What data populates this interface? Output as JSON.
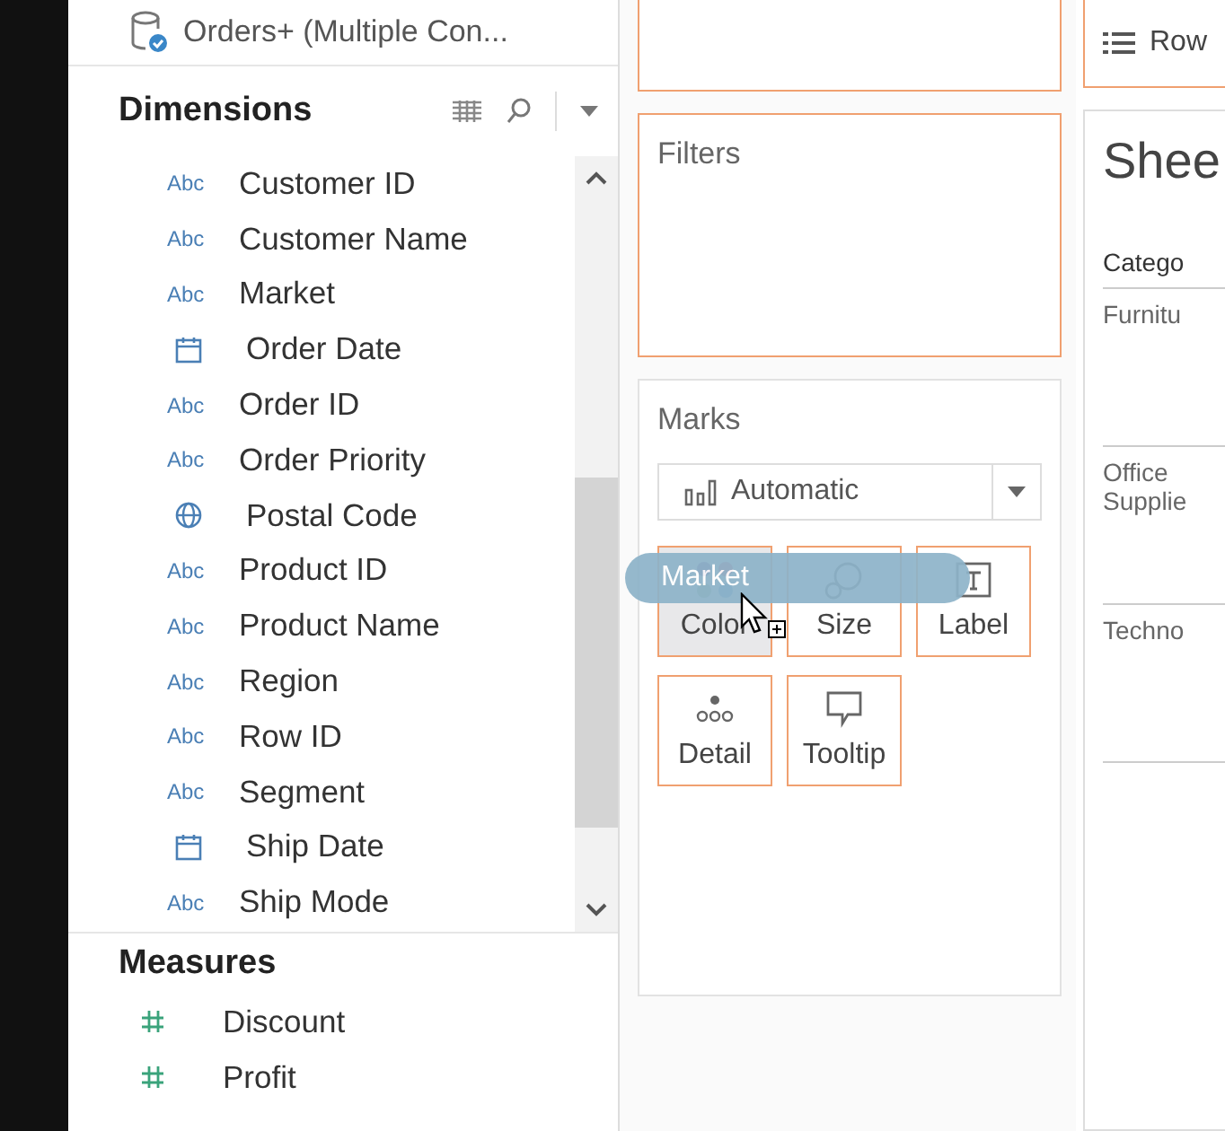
{
  "data_source": {
    "name": "Orders+ (Multiple Con..."
  },
  "dimensions": {
    "title": "Dimensions",
    "items": [
      {
        "kind": "string",
        "type_label": "Abc",
        "label": "Customer ID"
      },
      {
        "kind": "string",
        "type_label": "Abc",
        "label": "Customer Name"
      },
      {
        "kind": "string",
        "type_label": "Abc",
        "label": "Market"
      },
      {
        "kind": "date",
        "label": "Order Date"
      },
      {
        "kind": "string",
        "type_label": "Abc",
        "label": "Order ID"
      },
      {
        "kind": "string",
        "type_label": "Abc",
        "label": "Order Priority"
      },
      {
        "kind": "geo",
        "label": "Postal Code"
      },
      {
        "kind": "string",
        "type_label": "Abc",
        "label": "Product ID"
      },
      {
        "kind": "string",
        "type_label": "Abc",
        "label": "Product Name"
      },
      {
        "kind": "string",
        "type_label": "Abc",
        "label": "Region"
      },
      {
        "kind": "string",
        "type_label": "Abc",
        "label": "Row ID"
      },
      {
        "kind": "string",
        "type_label": "Abc",
        "label": "Segment"
      },
      {
        "kind": "date",
        "label": "Ship Date"
      },
      {
        "kind": "string",
        "type_label": "Abc",
        "label": "Ship Mode"
      }
    ]
  },
  "measures": {
    "title": "Measures",
    "items": [
      {
        "kind": "number",
        "label": "Discount"
      },
      {
        "kind": "number",
        "label": "Profit"
      }
    ]
  },
  "filters": {
    "title": "Filters"
  },
  "marks": {
    "title": "Marks",
    "mark_type": "Automatic",
    "cards": [
      {
        "kind": "color",
        "label": "Color"
      },
      {
        "kind": "size",
        "label": "Size"
      },
      {
        "kind": "label",
        "label": "Label"
      },
      {
        "kind": "detail",
        "label": "Detail"
      },
      {
        "kind": "tooltip",
        "label": "Tooltip"
      }
    ]
  },
  "drag_pill": {
    "label": "Market"
  },
  "rows_shelf": {
    "label": "Row"
  },
  "sheet": {
    "title": "Shee",
    "column_header": "Catego",
    "rows": [
      "Furnitu",
      "Office\nSupplie",
      "Techno"
    ]
  }
}
